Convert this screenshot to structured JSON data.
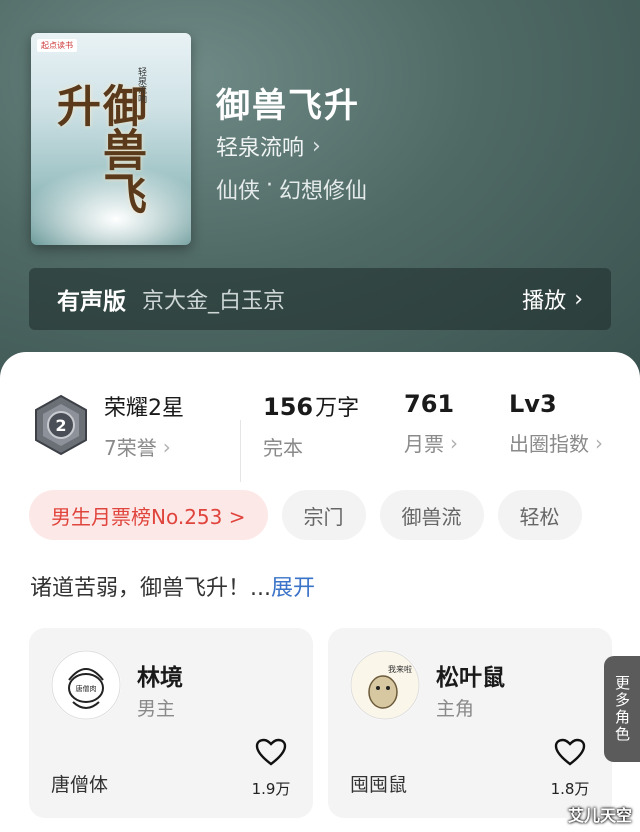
{
  "book": {
    "cover_brand": "起点读书",
    "cover_title": "御兽飞升",
    "cover_author": "轻泉流响",
    "title": "御兽飞升",
    "author": "轻泉流响",
    "tags": [
      "仙侠",
      "·",
      "幻想修仙"
    ]
  },
  "audio": {
    "label": "有声版",
    "narrator": "京大金_白玉京",
    "play_label": "播放"
  },
  "stats": {
    "honor_level": "2",
    "honor_title": "荣耀2星",
    "honor_sub": "7荣誉",
    "words_value": "156",
    "words_unit": "万字",
    "words_sub": "完本",
    "tickets_value": "761",
    "tickets_sub": "月票",
    "index_value": "Lv3",
    "index_sub": "出圈指数"
  },
  "chips": [
    "男生月票榜No.253 >",
    "宗门",
    "御兽流",
    "轻松"
  ],
  "intro": {
    "text": "诸道苦弱，御兽飞升！...",
    "more": "展开"
  },
  "characters": [
    {
      "name": "林境",
      "role": "男主",
      "creator": "唐僧体",
      "likes": "1.9万",
      "avatar_text": "唐僧肉"
    },
    {
      "name": "松叶鼠",
      "role": "主角",
      "creator": "囤囤鼠",
      "likes": "1.8万",
      "avatar_text": "我来啦"
    }
  ],
  "more_roles": "更多角色",
  "watermark": "艾儿天空",
  "colors": {
    "hero_bg": "#4f6965",
    "rank_chip_bg": "#fde8e8",
    "rank_chip_text": "#e0453d",
    "link": "#3a73c8",
    "more_roles_bg": "#5b5b5b"
  }
}
